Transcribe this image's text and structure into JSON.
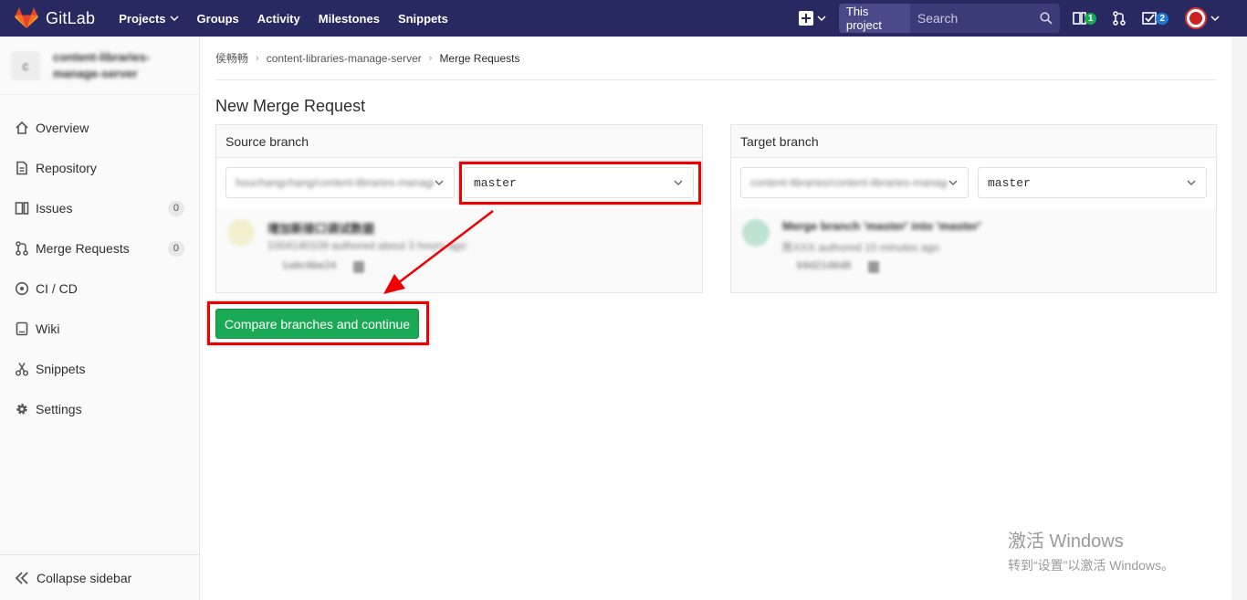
{
  "navbar": {
    "brand": "GitLab",
    "links": [
      {
        "label": "Projects",
        "has_dropdown": true
      },
      {
        "label": "Groups"
      },
      {
        "label": "Activity"
      },
      {
        "label": "Milestones"
      },
      {
        "label": "Snippets"
      }
    ],
    "search_scope": "This project",
    "search_placeholder": "Search",
    "issues_badge": "1",
    "todos_badge": "2",
    "colors": {
      "background": "#292961",
      "scope_bg": "#4a4a8a",
      "search_bg": "#3b3b78"
    }
  },
  "sidebar": {
    "project_avatar_letter": "c",
    "project_name": "content-libraries-manage-server",
    "items": [
      {
        "label": "Overview",
        "icon": "home-icon"
      },
      {
        "label": "Repository",
        "icon": "doc-icon"
      },
      {
        "label": "Issues",
        "icon": "issues-icon",
        "count": "0"
      },
      {
        "label": "Merge Requests",
        "icon": "git-merge-icon",
        "count": "0"
      },
      {
        "label": "CI / CD",
        "icon": "rocket-icon"
      },
      {
        "label": "Wiki",
        "icon": "book-icon"
      },
      {
        "label": "Snippets",
        "icon": "scissors-icon"
      },
      {
        "label": "Settings",
        "icon": "gear-icon"
      }
    ],
    "collapse_label": "Collapse sidebar"
  },
  "breadcrumb": {
    "group": "侯畅畅",
    "project": "content-libraries-manage-server",
    "current": "Merge Requests"
  },
  "page": {
    "title": "New Merge Request"
  },
  "source": {
    "header": "Source branch",
    "project_value": "houchangchang/content-libraries-manage-server",
    "branch_value": "master",
    "commit_title": "增加新接口调试数据",
    "commit_meta": "1004140109 authored about 3 hours ago",
    "commit_sha": "1a6c0be24"
  },
  "target": {
    "header": "Target branch",
    "project_value": "content-libraries/content-libraries-manage-server",
    "branch_value": "master",
    "commit_title": "Merge branch 'master' into 'master'",
    "commit_meta": "陈XXX authored 10 minutes ago",
    "commit_sha": "b9d21d6d8"
  },
  "actions": {
    "compare_label": "Compare branches and continue",
    "button_color": "#1aaa55",
    "highlight_color": "#e00000"
  },
  "watermark": {
    "title": "激活 Windows",
    "subtitle": "转到“设置”以激活 Windows。"
  }
}
